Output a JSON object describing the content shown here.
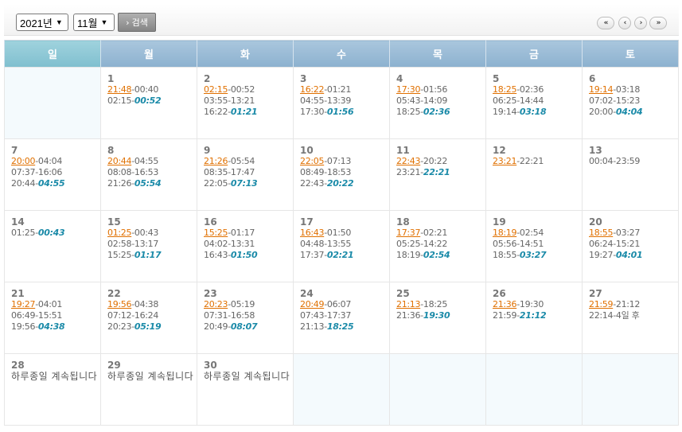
{
  "toolbar": {
    "year_selected": "2021년",
    "month_selected": "11월",
    "search_label": "검색",
    "nav_first": "«",
    "nav_prev": "‹",
    "nav_next": "›",
    "nav_last": "»"
  },
  "weekdays": [
    "일",
    "월",
    "화",
    "수",
    "목",
    "금",
    "토"
  ],
  "weeks": [
    [
      null,
      {
        "day": "1",
        "a": "21:48",
        "b": "-00:40",
        "l2": "02:15-",
        "l2e": "00:52"
      },
      {
        "day": "2",
        "a": "02:15",
        "b": "-00:52",
        "l2": "03:55-13:21",
        "l3": "16:22-",
        "l3e": "01:21"
      },
      {
        "day": "3",
        "a": "16:22",
        "b": "-01:21",
        "l2": "04:55-13:39",
        "l3": "17:30-",
        "l3e": "01:56"
      },
      {
        "day": "4",
        "a": "17:30",
        "b": "-01:56",
        "l2": "05:43-14:09",
        "l3": "18:25-",
        "l3e": "02:36"
      },
      {
        "day": "5",
        "a": "18:25",
        "b": "-02:36",
        "l2": "06:25-14:44",
        "l3": "19:14-",
        "l3e": "03:18"
      },
      {
        "day": "6",
        "a": "19:14",
        "b": "-03:18",
        "l2": "07:02-15:23",
        "l3": "20:00-",
        "l3e": "04:04"
      }
    ],
    [
      {
        "day": "7",
        "a": "20:00",
        "b": "-04:04",
        "l2": "07:37-16:06",
        "l3": "20:44-",
        "l3e": "04:55"
      },
      {
        "day": "8",
        "a": "20:44",
        "b": "-04:55",
        "l2": "08:08-16:53",
        "l3": "21:26-",
        "l3e": "05:54"
      },
      {
        "day": "9",
        "a": "21:26",
        "b": "-05:54",
        "l2": "08:35-17:47",
        "l3": "22:05-",
        "l3e": "07:13"
      },
      {
        "day": "10",
        "a": "22:05",
        "b": "-07:13",
        "l2": "08:49-18:53",
        "l3": "22:43-",
        "l3e": "20:22"
      },
      {
        "day": "11",
        "a": "22:43",
        "b": "-20:22",
        "l2": "23:21-",
        "l2e": "22:21"
      },
      {
        "day": "12",
        "a": "23:21",
        "b": "-22:21"
      },
      {
        "day": "13",
        "l1": "00:04-23:59"
      }
    ],
    [
      {
        "day": "14",
        "l1": "01:25-",
        "l1e": "00:43"
      },
      {
        "day": "15",
        "a": "01:25",
        "b": "-00:43",
        "l2": "02:58-13:17",
        "l3": "15:25-",
        "l3e": "01:17"
      },
      {
        "day": "16",
        "a": "15:25",
        "b": "-01:17",
        "l2": "04:02-13:31",
        "l3": "16:43-",
        "l3e": "01:50"
      },
      {
        "day": "17",
        "a": "16:43",
        "b": "-01:50",
        "l2": "04:48-13:55",
        "l3": "17:37-",
        "l3e": "02:21"
      },
      {
        "day": "18",
        "a": "17:37",
        "b": "-02:21",
        "l2": "05:25-14:22",
        "l3": "18:19-",
        "l3e": "02:54"
      },
      {
        "day": "19",
        "a": "18:19",
        "b": "-02:54",
        "l2": "05:56-14:51",
        "l3": "18:55-",
        "l3e": "03:27"
      },
      {
        "day": "20",
        "a": "18:55",
        "b": "-03:27",
        "l2": "06:24-15:21",
        "l3": "19:27-",
        "l3e": "04:01"
      }
    ],
    [
      {
        "day": "21",
        "a": "19:27",
        "b": "-04:01",
        "l2": "06:49-15:51",
        "l3": "19:56-",
        "l3e": "04:38"
      },
      {
        "day": "22",
        "a": "19:56",
        "b": "-04:38",
        "l2": "07:12-16:24",
        "l3": "20:23-",
        "l3e": "05:19"
      },
      {
        "day": "23",
        "a": "20:23",
        "b": "-05:19",
        "l2": "07:31-16:58",
        "l3": "20:49-",
        "l3e": "08:07"
      },
      {
        "day": "24",
        "a": "20:49",
        "b": "-06:07",
        "l2": "07:43-17:37",
        "l3": "21:13-",
        "l3e": "18:25"
      },
      {
        "day": "25",
        "a": "21:13",
        "b": "-18:25",
        "l2": "21:36-",
        "l2e": "19:30"
      },
      {
        "day": "26",
        "a": "21:36",
        "b": "-19:30",
        "l2": "21:59-",
        "l2e": "21:12"
      },
      {
        "day": "27",
        "a": "21:59",
        "b": "-21:12",
        "l2": "22:14-4일 후"
      }
    ],
    [
      {
        "day": "28",
        "note": "하루종일 계속됩니다"
      },
      {
        "day": "29",
        "note": "하루종일 계속됩니다"
      },
      {
        "day": "30",
        "note": "하루종일 계속됩니다"
      },
      null,
      null,
      null,
      null
    ]
  ],
  "colors": {
    "header_bg": "#8cb1cf",
    "header_sun_bg": "#7fbfcf",
    "highlight_time": "#e07000",
    "emphasis_time": "#1a8aa8",
    "blank_cell": "#f4fafd"
  }
}
